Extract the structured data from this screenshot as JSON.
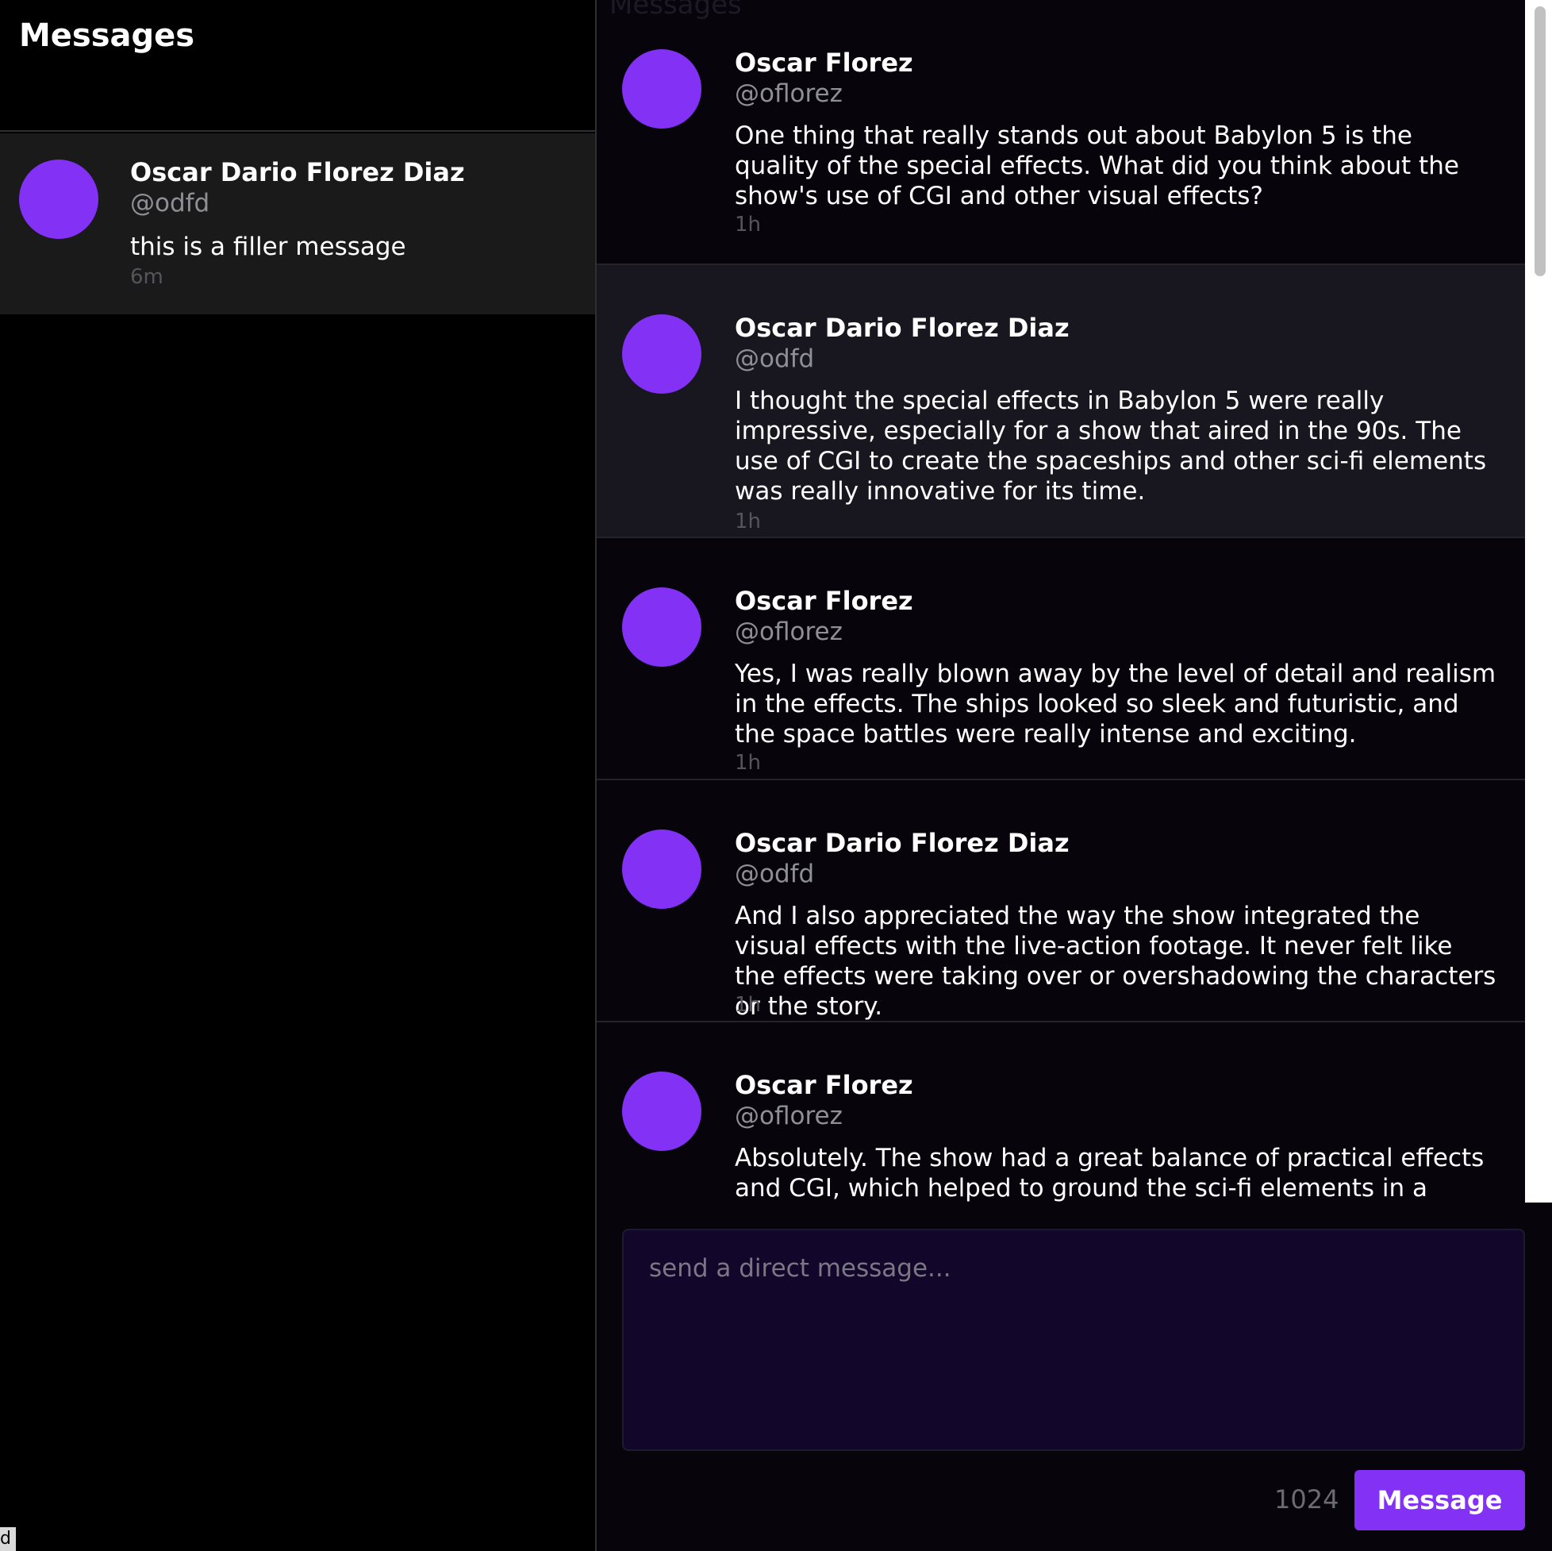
{
  "sidebar": {
    "title": "Messages",
    "conversations": [
      {
        "name": "Oscar Dario Florez Diaz",
        "handle": "@odfd",
        "preview": "this is a filler message",
        "time": "6m"
      }
    ],
    "corner_badge": "d"
  },
  "thread": {
    "ghost_title": "Messages",
    "messages": [
      {
        "name": "Oscar Florez",
        "handle": "@oflorez",
        "text": "One thing that really stands out about Babylon 5 is the quality of the special effects. What did you think about the show's use of CGI and other visual effects?",
        "time": "1h"
      },
      {
        "name": "Oscar Dario Florez Diaz",
        "handle": "@odfd",
        "text": "I thought the special effects in Babylon 5 were really impressive, especially for a show that aired in the 90s. The use of CGI to create the spaceships and other sci-fi elements was really innovative for its time.",
        "time": "1h"
      },
      {
        "name": "Oscar Florez",
        "handle": "@oflorez",
        "text": "Yes, I was really blown away by the level of detail and realism in the effects. The ships looked so sleek and futuristic, and the space battles were really intense and exciting.",
        "time": "1h"
      },
      {
        "name": "Oscar Dario Florez Diaz",
        "handle": "@odfd",
        "text": "And I also appreciated the way the show integrated the visual effects with the live-action footage. It never felt like the effects were taking over or overshadowing the characters or the story.",
        "time": "1h"
      },
      {
        "name": "Oscar Florez",
        "handle": "@oflorez",
        "text": "Absolutely. The show had a great balance of practical effects and CGI, which helped to ground the sci-fi elements in a more tangible and realistic world.",
        "time": ""
      }
    ]
  },
  "composer": {
    "placeholder": "send a direct message...",
    "value": "",
    "char_count": "1024",
    "send_label": "Message"
  },
  "colors": {
    "accent": "#8331f5",
    "background": "#000000",
    "thread_background": "#07040c",
    "thread_alt_row": "#18161f",
    "composer_background": "#12072a",
    "muted_text": "#8f8f96",
    "timestamp_text": "#55555c"
  }
}
